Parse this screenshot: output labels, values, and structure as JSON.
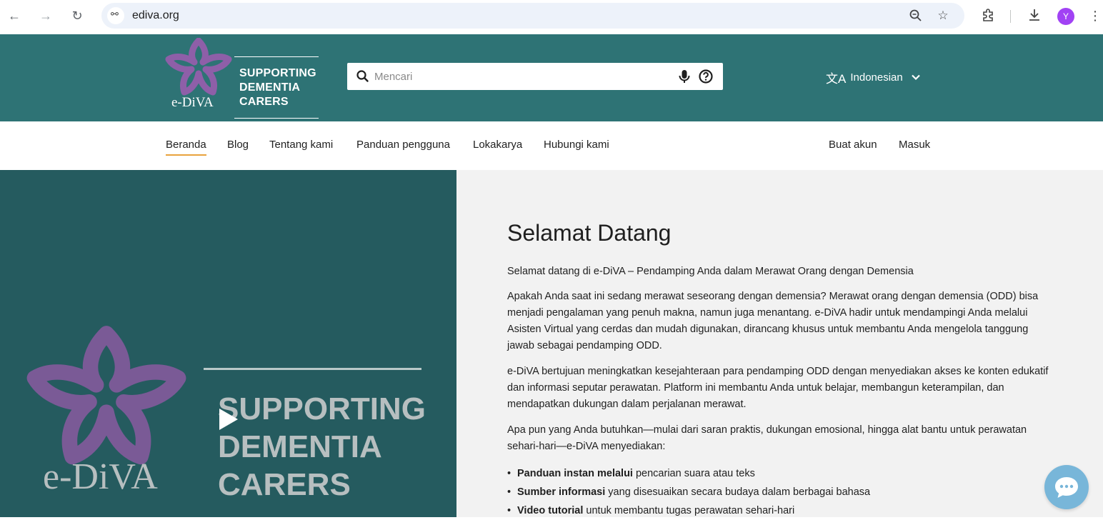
{
  "browser": {
    "url": "ediva.org",
    "profile_initial": "Y"
  },
  "header": {
    "logo_tagline": [
      "SUPPORTING",
      "DEMENTIA",
      "CARERS"
    ],
    "logo_wordmark": "e-DiVA",
    "search_placeholder": "Mencari",
    "language": "Indonesian"
  },
  "nav": {
    "items": [
      {
        "label": "Beranda",
        "active": true
      },
      {
        "label": "Blog"
      },
      {
        "label": "Tentang kami"
      },
      {
        "label": "Panduan pengguna"
      },
      {
        "label": "Lokakarya"
      },
      {
        "label": "Hubungi kami"
      }
    ],
    "auth": {
      "register": "Buat akun",
      "login": "Masuk"
    }
  },
  "hero_video": {
    "tagline": [
      "SUPPORTING",
      "DEMENTIA",
      "CARERS"
    ],
    "wordmark": "e-DiVA"
  },
  "welcome": {
    "title": "Selamat Datang",
    "intro": "Selamat datang di e-DiVA – Pendamping Anda dalam Merawat Orang dengan Demensia",
    "paragraphs": [
      "Apakah Anda saat ini sedang merawat seseorang dengan demensia? Merawat orang dengan demensia (ODD) bisa menjadi pengalaman yang penuh makna, namun juga menantang. e-DiVA hadir untuk mendampingi Anda melalui Asisten Virtual yang cerdas dan mudah digunakan, dirancang khusus untuk membantu Anda mengelola tanggung jawab sebagai pendamping ODD.",
      "e-DiVA bertujuan meningkatkan kesejahteraan para pendamping ODD dengan menyediakan akses ke konten edukatif dan informasi seputar perawatan. Platform ini membantu Anda untuk belajar, membangun keterampilan, dan mendapatkan dukungan dalam perjalanan merawat.",
      "Apa pun yang Anda butuhkan—mulai dari saran praktis, dukungan emosional, hingga alat bantu untuk perawatan sehari-hari—e-DiVA menyediakan:"
    ],
    "features": [
      {
        "bold": "Panduan instan melalui",
        "rest": " pencarian suara atau teks"
      },
      {
        "bold": "Sumber informasi",
        "rest": " yang disesuaikan secara budaya dalam berbagai bahasa"
      },
      {
        "bold": "Video tutorial",
        "rest": " untuk membantu tugas perawatan sehari-hari"
      }
    ]
  },
  "colors": {
    "header_teal": "#2e7375",
    "hero_teal": "#255b5f",
    "logo_purple": "#8e5fa8",
    "nav_active_underline": "#e8a33d",
    "chat_blue": "#78b6d9"
  }
}
